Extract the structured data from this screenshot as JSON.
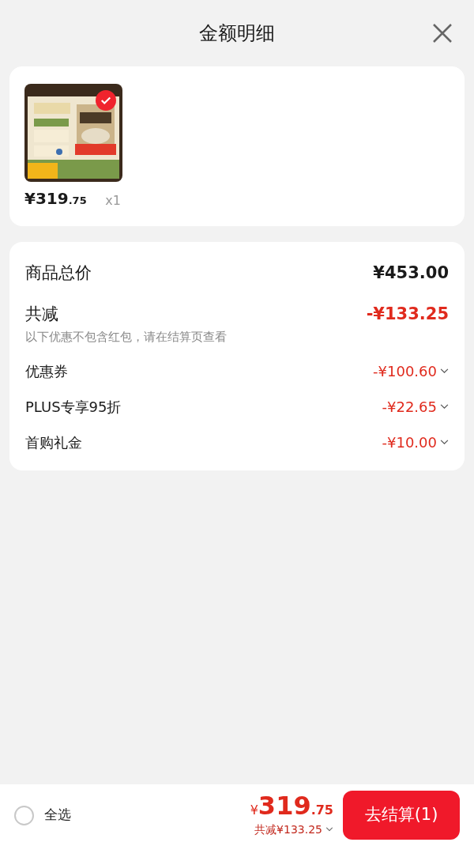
{
  "header": {
    "title": "金额明细"
  },
  "items": [
    {
      "selected": true,
      "price_main": "¥319",
      "price_decimal": ".75",
      "quantity": "x1"
    }
  ],
  "summary": {
    "total_label": "商品总价",
    "total_value": "¥453.00",
    "discount_label": "共减",
    "discount_value": "-¥133.25",
    "note": "以下优惠不包含红包，请在结算页查看",
    "discounts": [
      {
        "label": "优惠券",
        "value": "-¥100.60"
      },
      {
        "label": "PLUS专享95折",
        "value": "-¥22.65"
      },
      {
        "label": "首购礼金",
        "value": "-¥10.00"
      }
    ]
  },
  "footer": {
    "select_all": {
      "label": "全选",
      "checked": false
    },
    "currency": "¥",
    "amount_main": "319",
    "amount_decimal": ".75",
    "saved": "共减¥133.25",
    "checkout": "去结算(1)"
  }
}
